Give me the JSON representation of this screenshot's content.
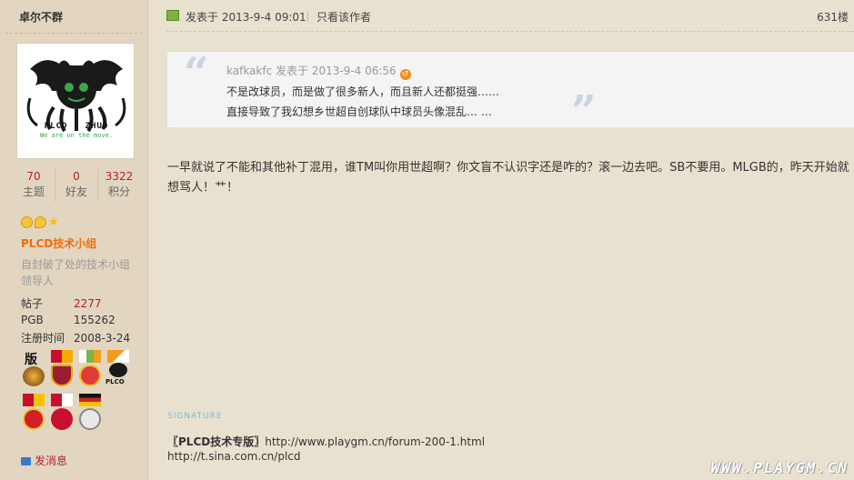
{
  "sidebar": {
    "username": "卓尔不群",
    "avatar_text": {
      "line1": "PLCD - ZHUO",
      "line2": "We are on the move."
    },
    "stats": [
      {
        "value": "70",
        "label": "主题"
      },
      {
        "value": "0",
        "label": "好友"
      },
      {
        "value": "3322",
        "label": "积分"
      }
    ],
    "group_name": "PLCD技术小组",
    "group_desc": "自封破了处的技术小组领导人",
    "info": [
      {
        "key": "帖子",
        "value": "2277"
      },
      {
        "key": "PGB",
        "value": "155262"
      },
      {
        "key": "注册时间",
        "value": "2008-3-24"
      }
    ],
    "medal_text": {
      "ban": "版",
      "plco": "PLCO"
    },
    "pm_label": "发消息"
  },
  "post": {
    "meta": "发表于 2013-9-4 09:01",
    "only_author": "只看该作者",
    "views": "631楼",
    "quote": {
      "header": "kafkakfc 发表于 2013-9-4 06:56",
      "lines": [
        "不是改球员，而是做了很多新人，而且新人还都挺强……",
        "直接导致了我幻想乡世超自创球队中球员头像混乱… …"
      ]
    },
    "body": "一早就说了不能和其他补丁混用，谁TM叫你用世超啊？你文盲不认识字还是咋的？滚一边去吧。SB不要用。MLGB的，昨天开始就想骂人！艹！"
  },
  "signature": {
    "label": "SIGNATURE",
    "line1_bold": "〖PLCD技术专版〗",
    "line1_url": "http://www.playgm.cn/forum-200-1.html",
    "line2": "http://t.sina.com.cn/plcd"
  },
  "watermark": "WWW.PLAYGM.CN"
}
